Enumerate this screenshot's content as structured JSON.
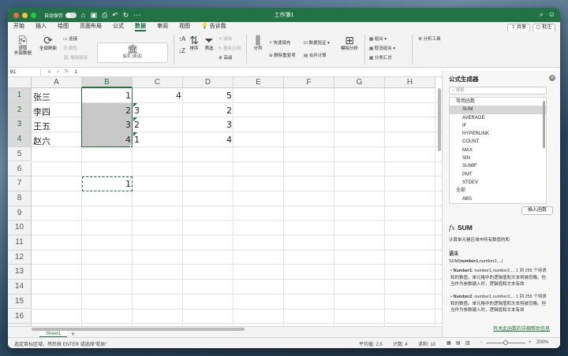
{
  "titlebar": {
    "autosave": "自动保存",
    "autosave_state": "off",
    "title": "工作簿1"
  },
  "menu": {
    "tabs": [
      "开始",
      "插入",
      "绘图",
      "页面布局",
      "公式",
      "数据",
      "审阅",
      "视图"
    ],
    "active": "数据",
    "tell_me": "告诉我",
    "share": "共享",
    "comment": "批注"
  },
  "ribbon": {
    "get_data": "获取\n外部数据",
    "refresh_all": "全部刷新",
    "connections": "连接",
    "properties": "属性",
    "edit_links": "编辑链接",
    "stocks": "股票 (英语)",
    "sort": "排序",
    "filter": "筛选",
    "clear": "清除",
    "reapply": "重新应用",
    "advanced": "高级",
    "text_to_columns": "分列",
    "flash_fill": "快速填充",
    "remove_duplicates": "删除重复项",
    "data_validation": "数据验证",
    "consolidate": "合并计算",
    "what_if": "模拟分析",
    "group": "组合",
    "ungroup": "取消组合",
    "subtotal": "分类汇总",
    "analysis_tools": "分析工具"
  },
  "formula_bar": {
    "name_box": "B1",
    "value": "1"
  },
  "sheet": {
    "columns": [
      "A",
      "B",
      "C",
      "D",
      "E",
      "F",
      "G",
      "H"
    ],
    "rows": [
      "1",
      "2",
      "3",
      "4",
      "5",
      "6",
      "7",
      "8",
      "9",
      "10",
      "11",
      "12",
      "13",
      "14",
      "15",
      "16",
      "17"
    ],
    "cells": {
      "A1": "张三",
      "A2": "李四",
      "A3": "王五",
      "A4": "赵六",
      "B1": "1",
      "B2": "2",
      "B3": "3",
      "B4": "4",
      "C1": "4",
      "C2": "3",
      "C3": "2",
      "C4": "1",
      "D1": "5",
      "D2": "2",
      "D3": "3",
      "D4": "4",
      "B7": "1"
    },
    "tab": "Sheet1",
    "add_sheet": "+"
  },
  "status": {
    "message": "选定目标区域，然后按 ENTER 或选择“粘贴”",
    "average": "平均值: 2.5",
    "count": "计数: 4",
    "sum": "求和: 10",
    "zoom": "200%"
  },
  "pane": {
    "title": "公式生成器",
    "search_placeholder": "搜索",
    "list": [
      {
        "label": "常用函数",
        "kind": "cat"
      },
      {
        "label": "SUM",
        "kind": "sel"
      },
      {
        "label": "AVERAGE",
        "kind": "fn"
      },
      {
        "label": "IF",
        "kind": "fn"
      },
      {
        "label": "HYPERLINK",
        "kind": "fn"
      },
      {
        "label": "COUNT",
        "kind": "fn"
      },
      {
        "label": "MAX",
        "kind": "fn"
      },
      {
        "label": "SIN",
        "kind": "fn"
      },
      {
        "label": "SUMIF",
        "kind": "fn"
      },
      {
        "label": "PMT",
        "kind": "fn"
      },
      {
        "label": "STDEV",
        "kind": "fn"
      },
      {
        "label": "全部",
        "kind": "cat"
      },
      {
        "label": "ABS",
        "kind": "fn"
      }
    ],
    "insert_button": "插入函数",
    "fx": "fx",
    "func_name": "SUM",
    "func_desc": "计算单元格区域中所有数值的和",
    "syntax_heading": "语法",
    "syntax_fn": "SUM(",
    "syntax_arg1": "number1",
    "syntax_rest": ",number2,...)",
    "arg1_name": "Number1",
    "arg1_desc": ": number1,number2,... 1 到 255 个待求和的数值。单元格中的逻辑值和文本将被忽略。但当作为参数键入时，逻辑值和文本有效",
    "arg2_name": "Number2",
    "arg2_desc": ": number1,number2,... 1 到 255 个待求和的数值。单元格中的逻辑值和文本将被忽略。但当作为参数键入时，逻辑值和文本有效",
    "help_link": "有关此函数的详细帮助信息"
  },
  "colors": {
    "accent": "#217346",
    "window_bg": "#ffffff",
    "selection_fill": "#c8c8c8"
  }
}
